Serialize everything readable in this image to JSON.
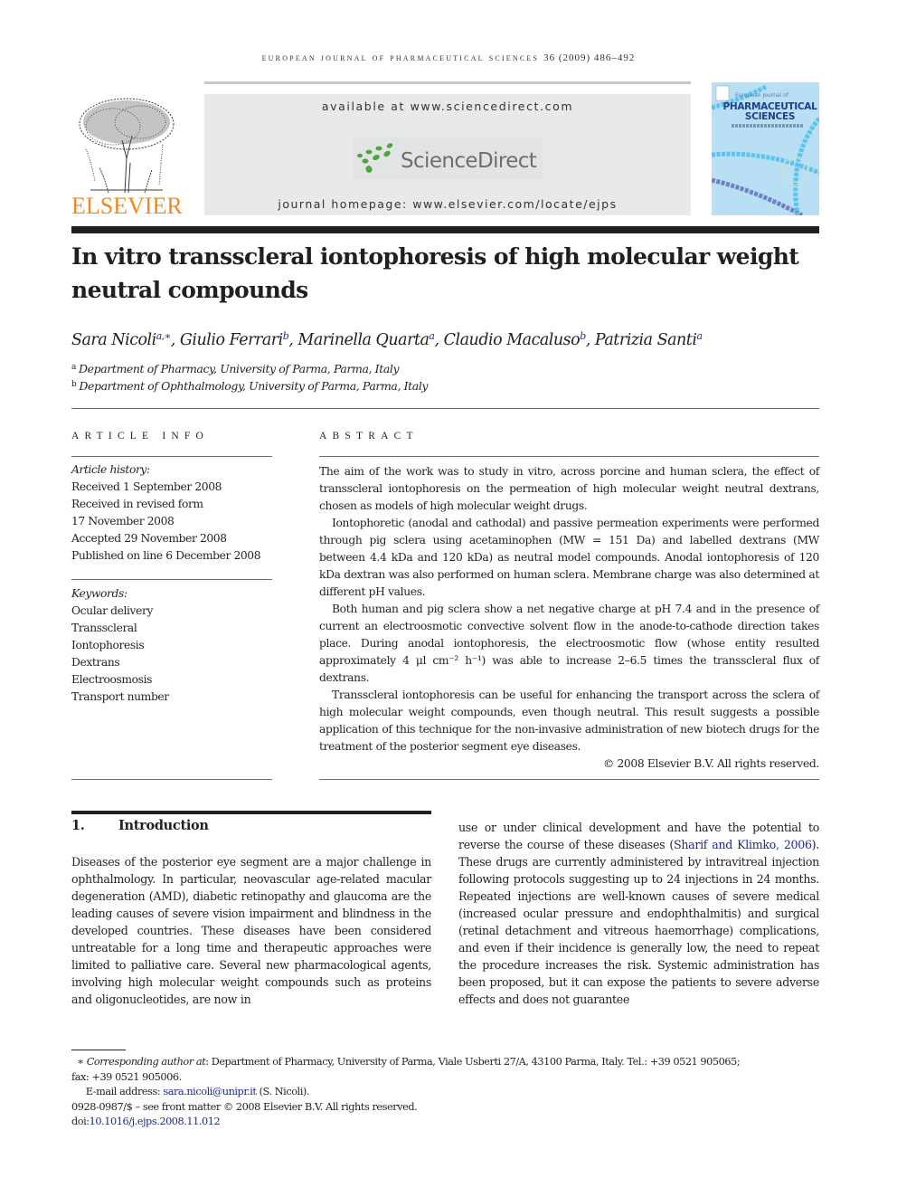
{
  "running_header": {
    "journal": "European Journal of Pharmaceutical Sciences",
    "citation": "36 (2009) 486–492"
  },
  "masthead": {
    "publisher_logo_text": "ELSEVIER",
    "available_at": "available at www.sciencedirect.com",
    "sciencedirect_logo_text": "ScienceDirect",
    "homepage": "journal homepage: www.elsevier.com/locate/ejps",
    "cover": {
      "small_text": "European Journal of",
      "title_line1": "PHARMACEUTICAL",
      "title_line2": "SCIENCES"
    },
    "colors": {
      "elsevier_orange": "#f08a1d",
      "sciencedirect_green": "#4aa83a",
      "sciencedirect_gray": "#6d6e70",
      "masthead_bg": "#e8e9ea",
      "cover_bg": "#b8dff3",
      "link_blue": "#1f2a8c"
    }
  },
  "article": {
    "title": "In vitro transscleral iontophoresis of high molecular weight neutral compounds",
    "authors": [
      {
        "name": "Sara Nicoli",
        "affil": "a,∗",
        "sep": ", "
      },
      {
        "name": "Giulio Ferrari",
        "affil": "b",
        "sep": ", "
      },
      {
        "name": "Marinella Quarta",
        "affil": "a",
        "sep": ", "
      },
      {
        "name": "Claudio Macaluso",
        "affil": "b",
        "sep": ", "
      },
      {
        "name": "Patrizia Santi",
        "affil": "a",
        "sep": ""
      }
    ],
    "affiliations": [
      {
        "mark": "a",
        "text": "Department of Pharmacy, University of Parma, Parma, Italy"
      },
      {
        "mark": "b",
        "text": "Department of Ophthalmology, University of Parma, Parma, Italy"
      }
    ]
  },
  "article_info": {
    "heading": "ARTICLE INFO",
    "history_label": "Article history:",
    "history": [
      "Received 1 September 2008",
      "Received in revised form",
      "17 November 2008",
      "Accepted 29 November 2008",
      "Published on line 6 December 2008"
    ],
    "keywords_label": "Keywords:",
    "keywords": [
      "Ocular delivery",
      "Transscleral",
      "Iontophoresis",
      "Dextrans",
      "Electroosmosis",
      "Transport number"
    ]
  },
  "abstract": {
    "heading": "ABSTRACT",
    "paragraphs": [
      "The aim of the work was to study in vitro, across porcine and human sclera, the effect of transscleral iontophoresis on the permeation of high molecular weight neutral dextrans, chosen as models of high molecular weight drugs.",
      "Iontophoretic (anodal and cathodal) and passive permeation experiments were performed through pig sclera using acetaminophen (MW = 151 Da) and labelled dextrans (MW between 4.4 kDa and 120 kDa) as neutral model compounds. Anodal iontophoresis of 120 kDa dextran was also performed on human sclera. Membrane charge was also determined at different pH values.",
      "Both human and pig sclera show a net negative charge at pH 7.4 and in the presence of current an electroosmotic convective solvent flow in the anode-to-cathode direction takes place. During anodal iontophoresis, the electroosmotic flow (whose entity resulted approximately 4 μl cm⁻² h⁻¹) was able to increase 2–6.5 times the transscleral flux of dextrans.",
      "Transscleral iontophoresis can be useful for enhancing the transport across the sclera of high molecular weight compounds, even though neutral. This result suggests a possible application of this technique for the non-invasive administration of new biotech drugs for the treatment of the posterior segment eye diseases."
    ],
    "copyright": "© 2008 Elsevier B.V. All rights reserved."
  },
  "introduction": {
    "number": "1.",
    "heading": "Introduction",
    "col1": "Diseases of the posterior eye segment are a major challenge in ophthalmology. In particular, neovascular age-related macular degeneration (AMD), diabetic retinopathy and glaucoma are the leading causes of severe vision impairment and blindness in the developed countries. These diseases have been considered untreatable for a long time and therapeutic approaches were limited to palliative care. Several new pharmacological agents, involving high molecular weight compounds such as proteins and oligonucleotides, are now in",
    "col2_before_ref": "use or under clinical development and have the potential to reverse the course of these diseases (",
    "col2_ref": "Sharif and Klimko, 2006",
    "col2_after_ref": "). These drugs are currently administered by intravitreal injection following protocols suggesting up to 24 injections in 24 months. Repeated injections are well-known causes of severe medical (increased ocular pressure and endophthalmitis) and surgical (retinal detachment and vitreous haemorrhage) complications, and even if their incidence is generally low, the need to repeat the procedure increases the risk. Systemic administration has been proposed, but it can expose the patients to severe adverse effects and does not guarantee"
  },
  "footnotes": {
    "corresponding_mark": "∗",
    "corresponding_label": "Corresponding author at",
    "corresponding_text": ": Department of Pharmacy, University of Parma, Viale Usberti 27/A, 43100 Parma, Italy. Tel.: +39 0521 905065;",
    "fax": "fax: +39 0521 905006.",
    "email_label": "E-mail address: ",
    "email": "sara.nicoli@unipr.it",
    "email_after": " (S. Nicoli).",
    "front_matter": "0928-0987/$ – see front matter © 2008 Elsevier B.V. All rights reserved.",
    "doi_label": "doi:",
    "doi": "10.1016/j.ejps.2008.11.012"
  }
}
